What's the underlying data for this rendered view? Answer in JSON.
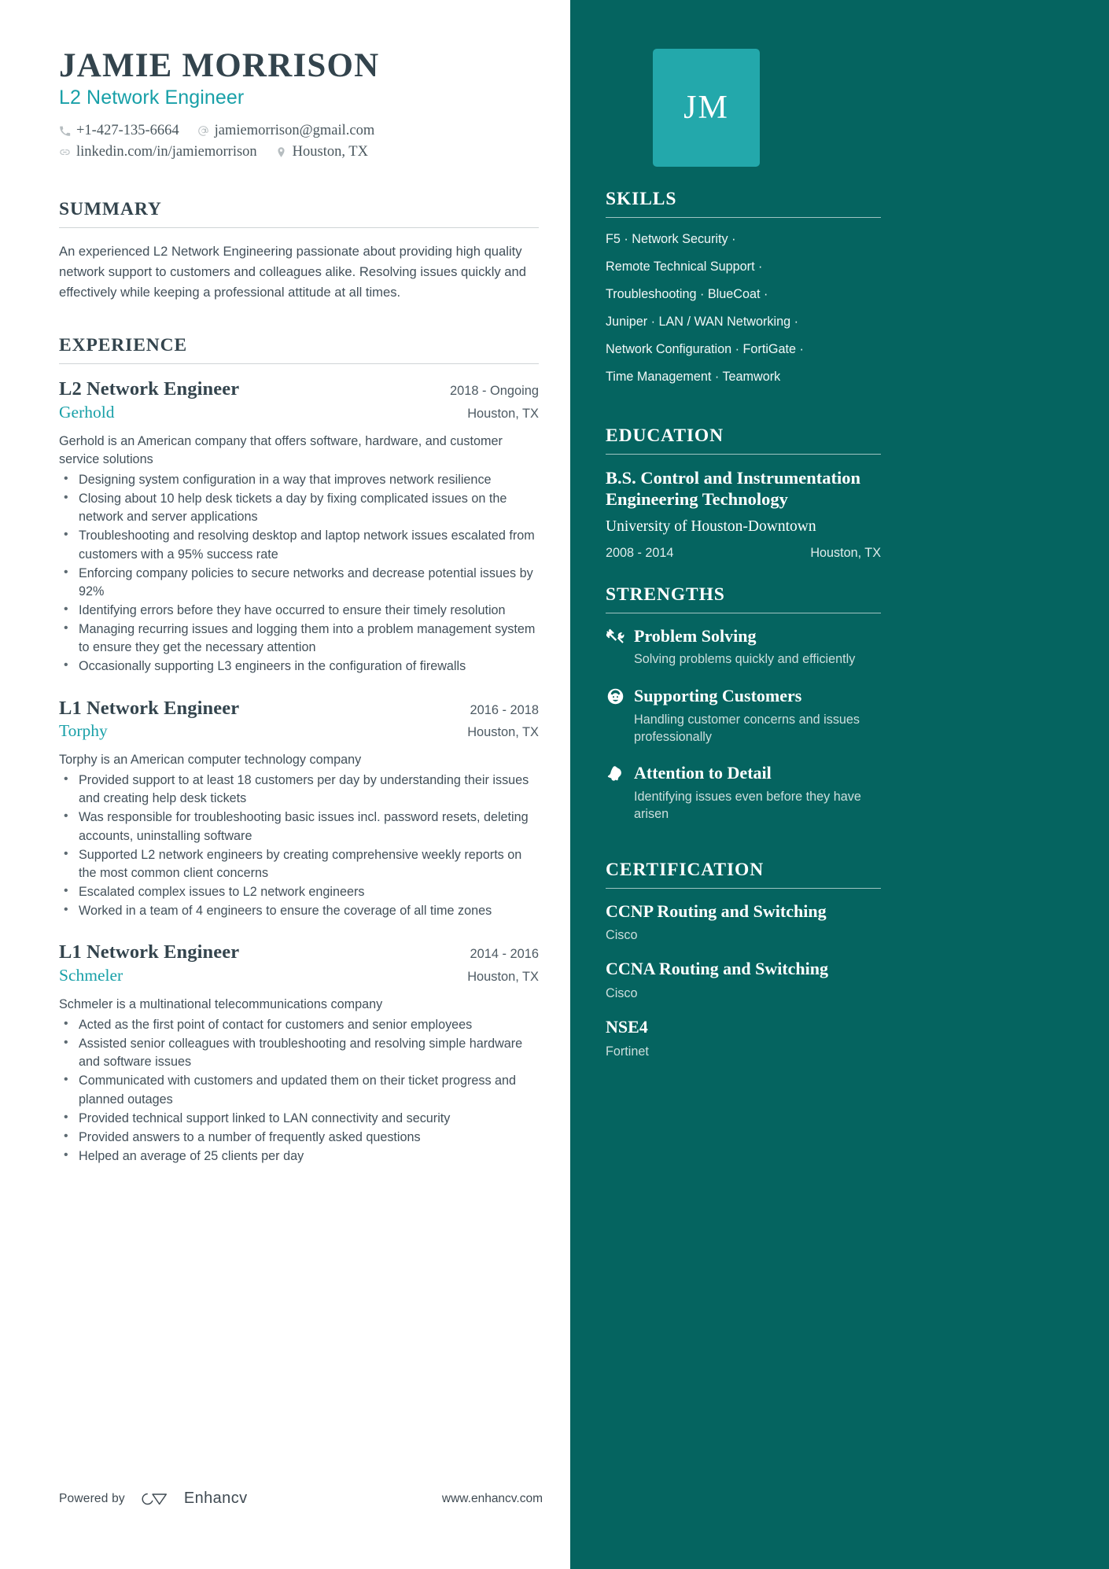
{
  "header": {
    "name": "JAMIE MORRISON",
    "role": "L2 Network Engineer",
    "initials": "JM",
    "contacts": [
      {
        "icon": "phone-icon",
        "text": "+1-427-135-6664"
      },
      {
        "icon": "email-icon",
        "text": "jamiemorrison@gmail.com"
      },
      {
        "icon": "link-icon",
        "text": "linkedin.com/in/jamiemorrison"
      },
      {
        "icon": "location-pin-icon",
        "text": "Houston, TX"
      }
    ]
  },
  "summary": {
    "title": "SUMMARY",
    "text": "An experienced L2 Network Engineering passionate about providing high quality network support to customers and colleagues alike. Resolving issues quickly and effectively while keeping a professional attitude at all times."
  },
  "experience": {
    "title": "EXPERIENCE",
    "jobs": [
      {
        "title": "L2 Network Engineer",
        "dates": "2018 - Ongoing",
        "company": "Gerhold",
        "location": "Houston, TX",
        "description": "Gerhold is an American company that offers software, hardware, and customer service solutions",
        "bullets": [
          "Designing system configuration in a way that improves network resilience",
          "Closing about 10 help desk tickets a day by fixing complicated issues on the network and server applications",
          "Troubleshooting and resolving desktop and laptop network issues escalated from customers with a 95% success rate",
          "Enforcing company policies to secure networks and decrease potential issues by 92%",
          "Identifying errors before they have occurred to ensure their timely resolution",
          "Managing recurring issues and logging them into a problem management system to ensure they get the necessary attention",
          "Occasionally supporting L3 engineers in the configuration of firewalls"
        ]
      },
      {
        "title": "L1 Network Engineer",
        "dates": "2016 - 2018",
        "company": "Torphy",
        "location": "Houston, TX",
        "description": "Torphy is an American computer technology company",
        "bullets": [
          "Provided support to at least 18 customers per day by understanding their issues and creating help desk tickets",
          "Was responsible for troubleshooting basic issues incl. password resets, deleting accounts, uninstalling software",
          "Supported L2 network engineers by creating comprehensive weekly reports on the most common client concerns",
          "Escalated complex issues to L2 network engineers",
          "Worked in a team of 4 engineers to ensure the coverage of all time zones"
        ]
      },
      {
        "title": "L1 Network Engineer",
        "dates": "2014 - 2016",
        "company": "Schmeler",
        "location": "Houston, TX",
        "description": "Schmeler is a multinational telecommunications company",
        "bullets": [
          "Acted as the first point of contact for customers and senior employees",
          "Assisted senior colleagues with troubleshooting and resolving simple hardware and software issues",
          "Communicated with customers and updated them on their ticket progress and planned outages",
          "Provided technical support linked to LAN connectivity and security",
          "Provided answers to a number of frequently asked questions",
          "Helped an average of 25 clients per day"
        ]
      }
    ]
  },
  "skills": {
    "title": "SKILLS",
    "lines": [
      "F5 · Network Security ·",
      "Remote Technical Support ·",
      "Troubleshooting · BlueCoat ·",
      "Juniper · LAN / WAN Networking ·",
      "Network Configuration · FortiGate ·",
      "Time Management · Teamwork"
    ]
  },
  "education": {
    "title": "EDUCATION",
    "degree": "B.S. Control and Instrumentation Engineering Technology",
    "school": "University of Houston-Downtown",
    "dates": "2008 - 2014",
    "location": "Houston, TX"
  },
  "strengths": {
    "title": "STRENGTHS",
    "items": [
      {
        "icon": "hammer-wrench-icon",
        "name": "Problem Solving",
        "description": "Solving problems quickly and efficiently"
      },
      {
        "icon": "headset-support-icon",
        "name": "Supporting Customers",
        "description": "Handling customer concerns and issues professionally"
      },
      {
        "icon": "bell-icon",
        "name": "Attention to Detail",
        "description": "Identifying issues even before they have arisen"
      }
    ]
  },
  "certification": {
    "title": "CERTIFICATION",
    "items": [
      {
        "name": "CCNP Routing and Switching",
        "issuer": "Cisco"
      },
      {
        "name": "CCNA Routing and Switching",
        "issuer": "Cisco"
      },
      {
        "name": "NSE4",
        "issuer": "Fortinet"
      }
    ]
  },
  "footer": {
    "powered_by": "Powered by",
    "brand": "Enhancv",
    "site": "www.enhancv.com"
  },
  "colors": {
    "sidebar_bg": "#056460",
    "avatar_bg": "#23a8ab",
    "accent": "#18a0a8",
    "heading": "#33444d"
  }
}
